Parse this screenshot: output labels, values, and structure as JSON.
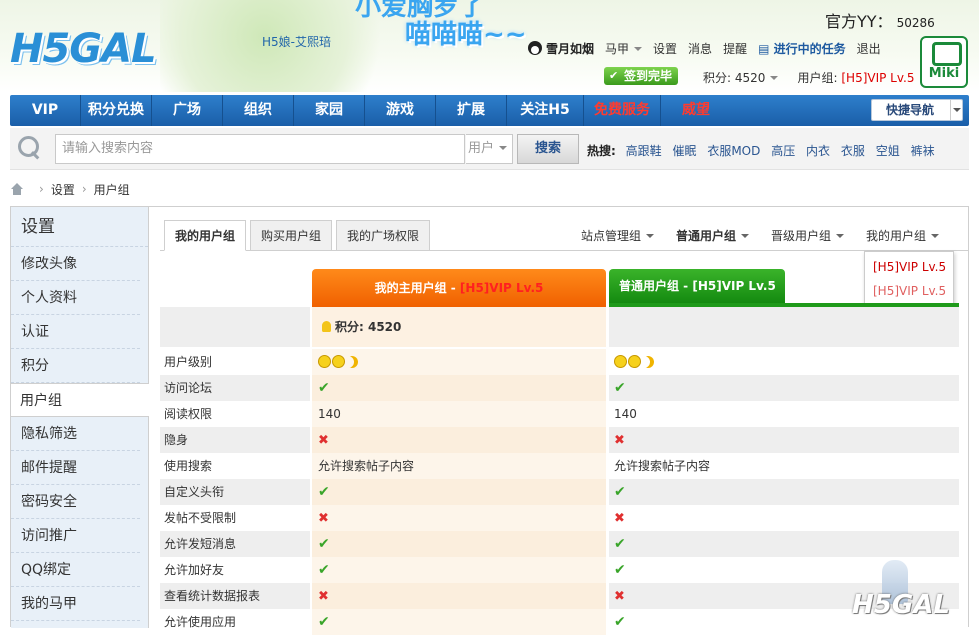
{
  "header": {
    "logo_text": "H5GAL",
    "mascot_name": "H5娘-艾熙琣",
    "slogan_top": "小爱胸罗了",
    "slogan": "喵喵喵~~",
    "yy_label": "官方YY：",
    "yy_number": "50286",
    "miki_badge": "Miki",
    "user": {
      "username": "雪月如烟",
      "items": [
        "马甲",
        "设置",
        "消息",
        "提醒"
      ],
      "task": "进行中的任务",
      "logout": "退出"
    },
    "sign_button": "签到完毕",
    "score_label": "积分: 4520",
    "usergroup_label": "用户组:",
    "usergroup_value": "[H5]VIP Lv.5"
  },
  "nav": {
    "items": [
      "VIP",
      "积分兑换",
      "广场",
      "组织",
      "家园",
      "游戏",
      "扩展",
      "关注H5",
      "免费服务",
      "威望"
    ],
    "quick_nav": "快捷导航"
  },
  "search": {
    "placeholder": "请输入搜索内容",
    "type": "用户",
    "button": "搜索",
    "hot_label": "热搜:",
    "hot_terms": [
      "高跟鞋",
      "催眠",
      "衣服MOD",
      "高压",
      "内衣",
      "衣服",
      "空姐",
      "裤袜"
    ]
  },
  "breadcrumb": [
    "设置",
    "用户组"
  ],
  "sidebar": {
    "title": "设置",
    "items": [
      "修改头像",
      "个人资料",
      "认证",
      "积分",
      "用户组",
      "隐私筛选",
      "邮件提醒",
      "密码安全",
      "访问推广",
      "QQ绑定",
      "我的马甲"
    ],
    "active": "用户组"
  },
  "tabs": [
    "我的用户组",
    "购买用户组",
    "我的广场权限"
  ],
  "group_nav": [
    "站点管理组",
    "普通用户组",
    "晋级用户组",
    "我的用户组"
  ],
  "dropdown": [
    "[H5]VIP Lv.5",
    "[H5]VIP Lv.5"
  ],
  "columns": {
    "main_prefix": "我的主用户组 - ",
    "main_vip": "[H5]VIP Lv.5",
    "normal": "普通用户组 - [H5]VIP Lv.5"
  },
  "score_row": "积分: 4520",
  "rows": [
    {
      "label": "用户级别",
      "v1": "level",
      "v2": "level"
    },
    {
      "label": "访问论坛",
      "v1": "yes",
      "v2": "yes"
    },
    {
      "label": "阅读权限",
      "v1": "140",
      "v2": "140"
    },
    {
      "label": "隐身",
      "v1": "no",
      "v2": "no"
    },
    {
      "label": "使用搜索",
      "v1": "允许搜索帖子内容",
      "v2": "允许搜索帖子内容"
    },
    {
      "label": "自定义头衔",
      "v1": "yes",
      "v2": "yes"
    },
    {
      "label": "发帖不受限制",
      "v1": "no",
      "v2": "no"
    },
    {
      "label": "允许发短消息",
      "v1": "yes",
      "v2": "yes"
    },
    {
      "label": "允许加好友",
      "v1": "yes",
      "v2": "yes"
    },
    {
      "label": "查看统计数据报表",
      "v1": "no",
      "v2": "no"
    },
    {
      "label": "允许使用应用",
      "v1": "yes",
      "v2": "yes"
    }
  ],
  "watermark": "H5GAL"
}
